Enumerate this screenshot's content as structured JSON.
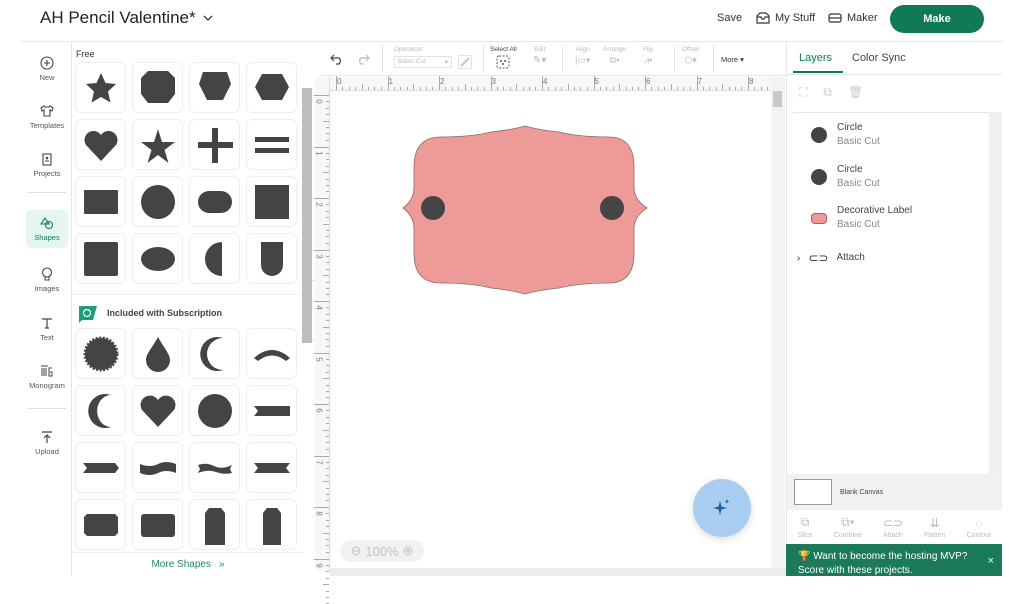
{
  "header": {
    "project_title": "AH Pencil Valentine*",
    "save_label": "Save",
    "my_stuff_label": "My Stuff",
    "maker_label": "Maker",
    "make_label": "Make"
  },
  "leftnav": {
    "items": [
      {
        "label": "New",
        "icon": "plus-circle-icon"
      },
      {
        "label": "Templates",
        "icon": "shirt-icon"
      },
      {
        "label": "Projects",
        "icon": "project-icon"
      },
      {
        "label": "Shapes",
        "icon": "shapes-icon",
        "active": true
      },
      {
        "label": "Images",
        "icon": "balloon-icon"
      },
      {
        "label": "Text",
        "icon": "text-icon"
      },
      {
        "label": "Monogram",
        "icon": "monogram-icon"
      },
      {
        "label": "Upload",
        "icon": "upload-icon"
      }
    ]
  },
  "shapes_panel": {
    "free_title": "Free",
    "free_shapes": [
      "star",
      "octagon",
      "pentagon",
      "hexagon",
      "heart",
      "star-thin",
      "plus",
      "equals",
      "rectangle",
      "circle",
      "rounded-rectangle",
      "square",
      "rounded-square",
      "oval",
      "half-circle",
      "arch"
    ],
    "subscription_title": "Included with Subscription",
    "subscription_shapes": [
      "starburst",
      "teardrop",
      "crescent",
      "arc",
      "crescent-thin",
      "heart",
      "scalloped-circle",
      "banner-notch",
      "banner-arrow",
      "wave-banner",
      "ribbon-wave",
      "banner-double-notch",
      "label-notched",
      "label-rounded",
      "tag",
      "tag-narrow"
    ],
    "more_shapes_label": "More Shapes"
  },
  "toolbar": {
    "undo": "undo",
    "redo": "redo",
    "operation_label": "Operation",
    "operation_value": "Basic Cut",
    "select_all_label": "Select All",
    "edit_label": "Edit",
    "align_label": "Align",
    "arrange_label": "Arrange",
    "flip_label": "Flip",
    "offset_label": "Offset",
    "more_label": "More"
  },
  "rulers": {
    "horizontal": [
      "0",
      "1",
      "2",
      "3",
      "4",
      "5",
      "6",
      "7",
      "8"
    ],
    "vertical": [
      "0",
      "1",
      "2",
      "3",
      "4",
      "5",
      "6",
      "7",
      "8",
      "9"
    ]
  },
  "canvas": {
    "zoom": "100%",
    "label_color": "#ed9a98",
    "circle_color": "#444444"
  },
  "right_panel": {
    "tabs": [
      "Layers",
      "Color Sync"
    ],
    "active_tab": "Layers",
    "layers": [
      {
        "name": "Circle",
        "operation": "Basic Cut",
        "color": "#444444"
      },
      {
        "name": "Circle",
        "operation": "Basic Cut",
        "color": "#444444"
      },
      {
        "name": "Decorative Label",
        "operation": "Basic Cut",
        "color": "#ed9a98"
      }
    ],
    "group_label": "Attach",
    "blank_canvas_label": "Blank Canvas",
    "bottom_tools": [
      "Slice",
      "Combine",
      "Attach",
      "Flatten",
      "Contour"
    ]
  },
  "promo": {
    "text_line1": "Want to become the hosting MVP?",
    "text_line2": "Score with these projects.",
    "close": "×"
  },
  "colors": {
    "brand_green": "#0f7a55",
    "promo_green": "#1a7a5a"
  }
}
